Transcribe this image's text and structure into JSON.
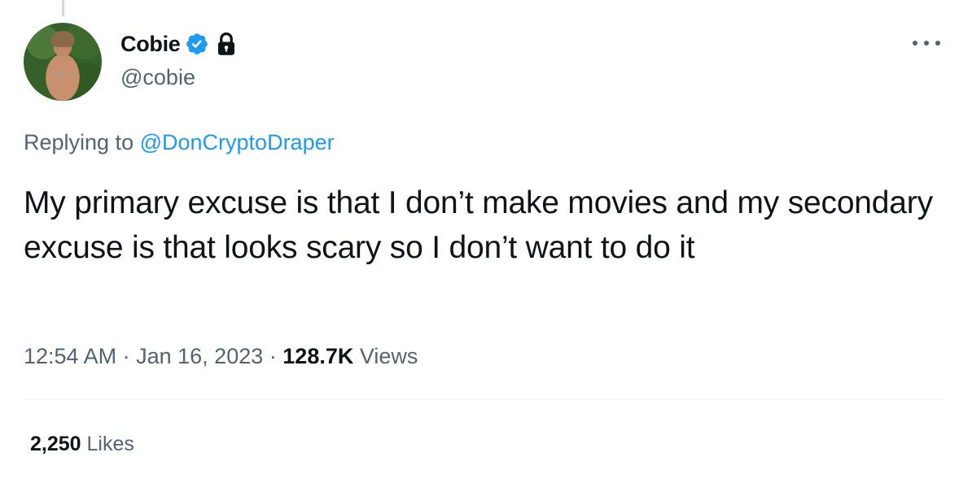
{
  "author": {
    "display_name": "Cobie",
    "handle": "@cobie",
    "verified_color": "#1d9bf0",
    "badges": [
      "verified-badge-icon",
      "lock-icon"
    ]
  },
  "reply": {
    "prefix": "Replying to",
    "mention": "@DonCryptoDraper"
  },
  "tweet": {
    "text": "My primary excuse is that I don’t make movies and my secondary excuse is that looks scary so I don’t want to do it"
  },
  "meta": {
    "time": "12:54 AM",
    "separator": "·",
    "date": "Jan 16, 2023",
    "views_count": "128.7K",
    "views_label": "Views"
  },
  "stats": {
    "likes_count": "2,250",
    "likes_label": "Likes"
  },
  "colors": {
    "accent": "#1d9bf0",
    "secondary_text": "#536471",
    "primary_text": "#0f1419"
  }
}
